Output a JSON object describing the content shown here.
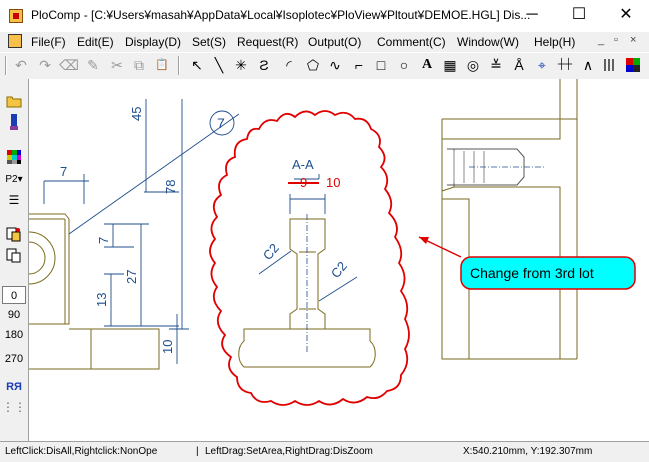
{
  "window": {
    "title": "PloComp - [C:¥Users¥masah¥AppData¥Local¥Isoplotec¥PloView¥Pltout¥DEMOE.HGL] Dis...",
    "minimize": "─",
    "maximize": "☐",
    "close": "✕"
  },
  "menu": {
    "items": [
      "File(F)",
      "Edit(E)",
      "Display(D)",
      "Set(S)",
      "Request(R)",
      "Output(O)",
      "Comment(C)",
      "Window(W)",
      "Help(H)"
    ],
    "mdi_min": "_",
    "mdi_restore": "▫",
    "mdi_close": "×"
  },
  "toolbar": {
    "undo": "↶",
    "redo": "↷",
    "eraser": "⌫",
    "pen": "✎",
    "cut": "✂",
    "copy": "⧉",
    "paste": "📋",
    "select": "↖",
    "line": "╲",
    "cross": "✳",
    "polyline": "Ƨ",
    "arc": "◜",
    "polygon": "⬠",
    "wave": "∿",
    "step": "⌐",
    "rect": "□",
    "ellipse": "○",
    "text": "A",
    "fill": "▦",
    "circle-mark": "◎",
    "dim-stack": "≚",
    "symbol-a": "Å",
    "target": "⌖",
    "vdim": "┼┼",
    "angle": "∧",
    "colors": "▦"
  },
  "left_toolbar": {
    "open": "📂",
    "pen_tool": "🖊",
    "palette": "▦",
    "pen_select": "P2▾",
    "layers": "☰",
    "copy2": "⧉",
    "paste2": "⧉",
    "angles": [
      "0",
      "90",
      "180",
      "270"
    ],
    "mirror": "RЯ",
    "grid": "⋮⋮"
  },
  "drawing": {
    "dims": {
      "d45": "45",
      "d78": "78",
      "d7a": "7",
      "d7b": "7",
      "d27": "27",
      "d13": "13",
      "d10": "10",
      "balloon": "7"
    },
    "section_label": "A-A",
    "red_fraction": "9",
    "red_value": "10",
    "chamfer1": "C2",
    "chamfer2": "C2",
    "callout": "Change from 3rd lot",
    "colors": {
      "dim": "#1f4e8c",
      "geometry": "#7a6a1e",
      "revision": "#e00000",
      "callout_fill": "#00ffff"
    }
  },
  "status": {
    "left": "LeftClick:DisAll,Rightclick:NonOpe",
    "middle": "LeftDrag:SetArea,RightDrag:DisZoom",
    "coords": "X:540.210mm, Y:192.307mm"
  }
}
